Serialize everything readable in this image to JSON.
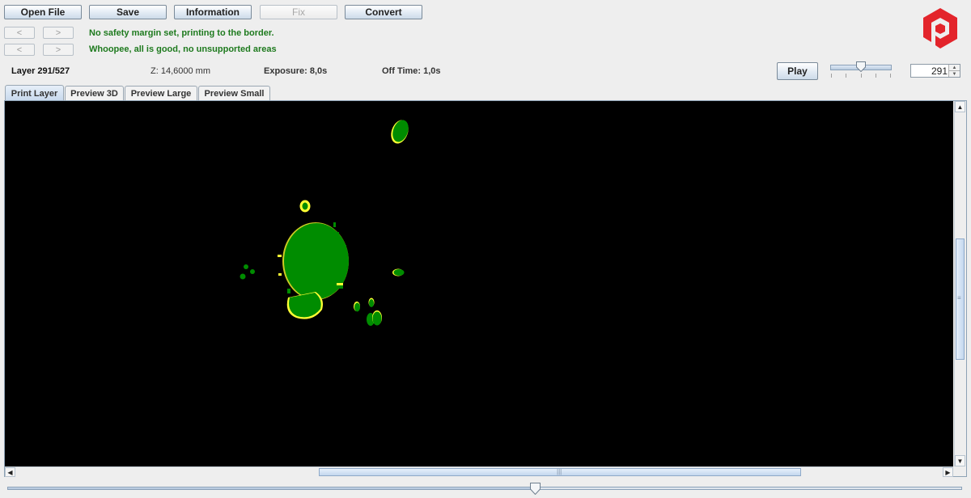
{
  "toolbar": {
    "open_file": "Open File",
    "save": "Save",
    "information": "Information",
    "fix": "Fix",
    "convert": "Convert"
  },
  "messages": [
    {
      "prev": "<",
      "next": ">",
      "text": "No safety margin set, printing to the border."
    },
    {
      "prev": "<",
      "next": ">",
      "text": "Whoopee, all is good, no unsupported areas"
    }
  ],
  "status": {
    "layer": "Layer 291/527",
    "z": "Z: 14,6000 mm",
    "exposure": "Exposure: 8,0s",
    "off_time": "Off Time: 1,0s"
  },
  "controls": {
    "play": "Play",
    "speed_slider_fraction": 0.5,
    "layer_spinner_value": "291",
    "spin_up": "▲",
    "spin_down": "▼"
  },
  "tabs": [
    {
      "label": "Print Layer",
      "active": true
    },
    {
      "label": "Preview 3D",
      "active": false
    },
    {
      "label": "Preview Large",
      "active": false
    },
    {
      "label": "Preview Small",
      "active": false
    }
  ],
  "layer_slider": {
    "current": 291,
    "total": 527
  },
  "colors": {
    "logo": "#e3242b",
    "layer_fill": "#008c00",
    "edge_highlight": "#ffff33",
    "message": "#1e7a1e",
    "canvas_bg": "#000000"
  },
  "icons": {
    "logo": "hexagon-p-logo",
    "scroll_up": "▲",
    "scroll_down": "▼",
    "scroll_left": "◀",
    "scroll_right": "▶",
    "grip_v": "≡",
    "grip_h": "|||"
  }
}
